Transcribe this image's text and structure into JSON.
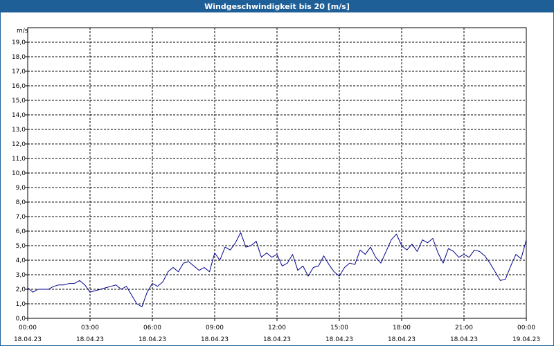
{
  "window": {
    "title": "Windgeschwindigkeit bis 20 [m/s]"
  },
  "chart_data": {
    "type": "line",
    "title": "Windgeschwindigkeit bis 20 [m/s]",
    "ylabel": "m/s",
    "xlabel": "",
    "ylim": [
      0,
      20
    ],
    "xlim_hours": [
      0,
      24
    ],
    "grid": true,
    "y_ticks": [
      "0,0",
      "1,0",
      "2,0",
      "3,0",
      "4,0",
      "5,0",
      "6,0",
      "7,0",
      "8,0",
      "9,0",
      "10,0",
      "11,0",
      "12,0",
      "13,0",
      "14,0",
      "15,0",
      "16,0",
      "17,0",
      "18,0",
      "19,0"
    ],
    "x_ticks": [
      {
        "time": "00:00",
        "date": "18.04.23"
      },
      {
        "time": "03:00",
        "date": "18.04.23"
      },
      {
        "time": "06:00",
        "date": "18.04.23"
      },
      {
        "time": "09:00",
        "date": "18.04.23"
      },
      {
        "time": "12:00",
        "date": "18.04.23"
      },
      {
        "time": "15:00",
        "date": "18.04.23"
      },
      {
        "time": "18:00",
        "date": "18.04.23"
      },
      {
        "time": "21:00",
        "date": "18.04.23"
      },
      {
        "time": "00:00",
        "date": "19.04.23"
      }
    ],
    "line_color": "#00008b",
    "series": [
      {
        "x_hours": [
          0.0,
          0.25,
          0.5,
          0.75,
          1.0,
          1.25,
          1.5,
          1.75,
          2.0,
          2.25,
          2.5,
          2.75,
          3.0,
          3.25,
          3.5,
          3.75,
          4.0,
          4.25,
          4.5,
          4.75,
          5.0,
          5.25,
          5.5,
          5.75,
          6.0,
          6.25,
          6.5,
          6.75,
          7.0,
          7.25,
          7.5,
          7.75,
          8.0,
          8.25,
          8.5,
          8.75,
          9.0,
          9.25,
          9.5,
          9.75,
          10.0,
          10.25,
          10.5,
          10.75,
          11.0,
          11.25,
          11.5,
          11.75,
          12.0,
          12.25,
          12.5,
          12.75,
          13.0,
          13.25,
          13.5,
          13.75,
          14.0,
          14.25,
          14.5,
          14.75,
          15.0,
          15.25,
          15.5,
          15.75,
          16.0,
          16.25,
          16.5,
          16.75,
          17.0,
          17.25,
          17.5,
          17.75,
          18.0,
          18.25,
          18.5,
          18.75,
          19.0,
          19.25,
          19.5,
          19.75,
          20.0,
          20.25,
          20.5,
          20.75,
          21.0,
          21.25,
          21.5,
          21.75,
          22.0,
          22.25,
          22.5,
          22.75,
          23.0,
          23.25,
          23.5,
          23.75,
          24.0
        ],
        "values": [
          2.1,
          1.8,
          2.0,
          2.0,
          2.0,
          2.2,
          2.3,
          2.3,
          2.4,
          2.4,
          2.6,
          2.3,
          1.8,
          1.9,
          2.0,
          2.1,
          2.2,
          2.3,
          2.0,
          2.2,
          1.6,
          1.0,
          0.8,
          1.8,
          2.4,
          2.2,
          2.5,
          3.2,
          3.5,
          3.2,
          3.8,
          3.9,
          3.6,
          3.3,
          3.5,
          3.2,
          4.5,
          4.0,
          4.9,
          4.7,
          5.2,
          5.9,
          4.9,
          5.0,
          5.3,
          4.2,
          4.5,
          4.2,
          4.4,
          3.6,
          3.8,
          4.4,
          3.3,
          3.6,
          2.9,
          3.5,
          3.6,
          4.3,
          3.7,
          3.2,
          2.9,
          3.5,
          3.8,
          3.7,
          4.7,
          4.4,
          4.9,
          4.2,
          3.8,
          4.6,
          5.4,
          5.8,
          5.0,
          4.7,
          5.1,
          4.6,
          5.4,
          5.2,
          5.5,
          4.5,
          3.8,
          4.8,
          4.6,
          4.2,
          4.4,
          4.2,
          4.7,
          4.6,
          4.3,
          3.8,
          3.2,
          2.6,
          2.7,
          3.6,
          4.4,
          4.1,
          5.4
        ]
      }
    ]
  }
}
